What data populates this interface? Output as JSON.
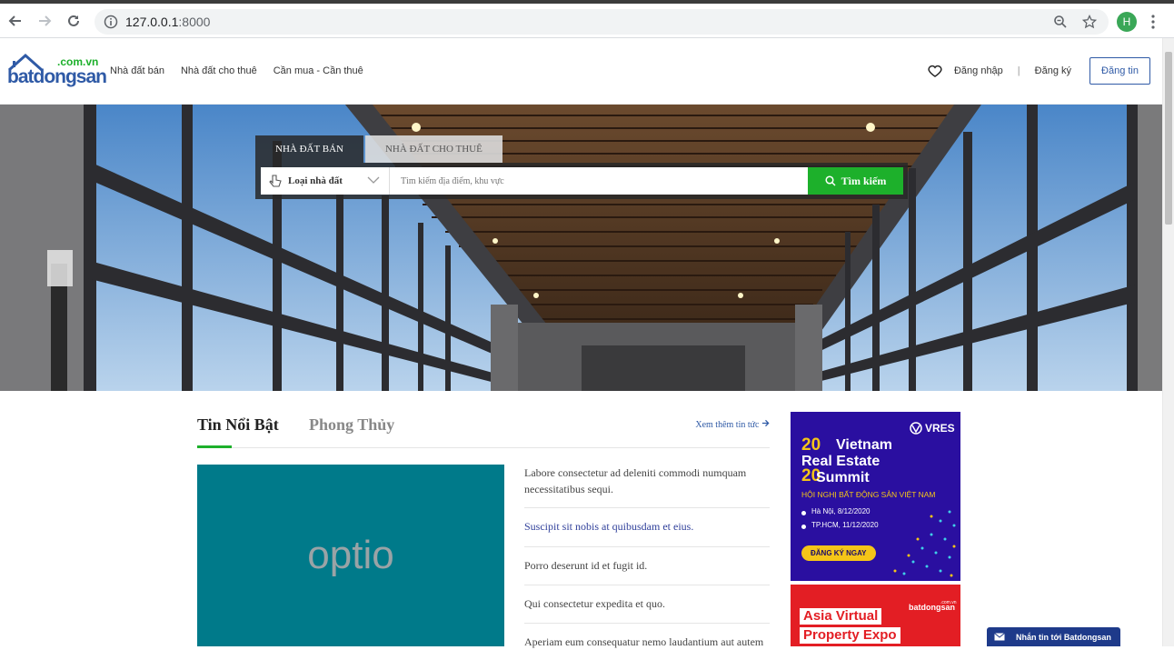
{
  "browser": {
    "url_host": "127.0.0.1",
    "url_port": ":8000",
    "profile_initial": "H"
  },
  "header": {
    "logo_domain": ".com.vn",
    "logo_name": "batdongsan",
    "menu": [
      "Nhà đất bán",
      "Nhà đất cho thuê",
      "Cần mua - Cần thuê"
    ],
    "login": "Đăng nhập",
    "separator": "|",
    "register": "Đăng ký",
    "post": "Đăng tin"
  },
  "search": {
    "tabs": [
      "NHÀ ĐẤT BÁN",
      "NHÀ ĐẤT CHO THUÊ"
    ],
    "type_label": "Loại nhà đất",
    "placeholder": "Tìm kiếm địa điểm, khu vực",
    "button": "Tìm kiếm"
  },
  "news": {
    "tab_featured": "Tin Nổi Bật",
    "tab_fengshui": "Phong Thủy",
    "more": "Xem thêm tin tức",
    "featured_image_text": "optio",
    "items": [
      "Labore consectetur ad deleniti commodi numquam necessitatibus sequi.",
      "Suscipit sit nobis at quibusdam et eius.",
      "Porro deserunt id et fugit id.",
      "Qui consectetur expedita et quo.",
      "Aperiam eum consequatur nemo laudantium aut autem"
    ]
  },
  "ads": {
    "vres": {
      "brand": "VRES",
      "year_top": "20",
      "year_bottom": "20",
      "title_1": "Vietnam",
      "title_2": "Real Estate",
      "title_3": "Summit",
      "subtitle": "HỘI NGHỊ BẤT ĐỘNG SẢN VIỆT NAM",
      "event_1": "Hà Nội, 8/12/2020",
      "event_2": "TP.HCM, 11/12/2020",
      "cta": "ĐĂNG KÝ NGAY"
    },
    "expo": {
      "line1": "Asia Virtual",
      "line2": "Property Expo",
      "logo_domain": ".com.vn",
      "logo_name": "batdongsan"
    }
  },
  "chat": {
    "label": "Nhắn tin tới Batdongsan"
  },
  "colors": {
    "brand_blue": "#2f5aa6",
    "search_green": "#1db02b",
    "featured_bg": "#007a8a",
    "vres_bg": "#2a0fa0",
    "expo_bg": "#e31e24"
  }
}
